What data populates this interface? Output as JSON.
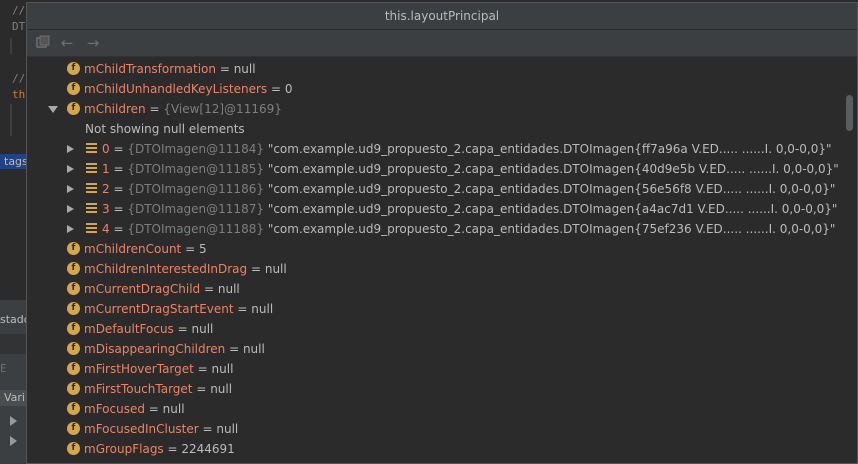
{
  "background": {
    "code_line1": "//",
    "code_line2": "DT",
    "code_line3": "//",
    "code_line4": "th",
    "tag_label": "tags",
    "estado_label": "stado",
    "vari_label": "Vari",
    "e_label": "E"
  },
  "window": {
    "title": "this.layoutPrincipal"
  },
  "toolbar": {
    "icons": [
      "copy-layout-icon",
      "back-arrow-icon",
      "forward-arrow-icon"
    ]
  },
  "tree": {
    "rows": [
      {
        "name": "mChildTransformation",
        "eq": " = ",
        "value": "null"
      },
      {
        "name": "mChildUnhandledKeyListeners",
        "eq": " = ",
        "value": "0"
      },
      {
        "name": "mChildren",
        "eq": " = ",
        "value": "{View[12]@11169}",
        "expanded": true
      },
      {
        "note": "Not showing null elements"
      },
      {
        "index": "0",
        "ref": "{DTOImagen@11184}",
        "value": "\"com.example.ud9_propuesto_2.capa_entidades.DTOImagen{ff7a96a V.ED..... ......I. 0,0-0,0}\""
      },
      {
        "index": "1",
        "ref": "{DTOImagen@11185}",
        "value": "\"com.example.ud9_propuesto_2.capa_entidades.DTOImagen{40d9e5b V.ED..... ......I. 0,0-0,0}\""
      },
      {
        "index": "2",
        "ref": "{DTOImagen@11186}",
        "value": "\"com.example.ud9_propuesto_2.capa_entidades.DTOImagen{56e56f8 V.ED..... ......I. 0,0-0,0}\""
      },
      {
        "index": "3",
        "ref": "{DTOImagen@11187}",
        "value": "\"com.example.ud9_propuesto_2.capa_entidades.DTOImagen{a4ac7d1 V.ED..... ......I. 0,0-0,0}\""
      },
      {
        "index": "4",
        "ref": "{DTOImagen@11188}",
        "value": "\"com.example.ud9_propuesto_2.capa_entidades.DTOImagen{75ef236 V.ED..... ......I. 0,0-0,0}\""
      },
      {
        "name": "mChildrenCount",
        "eq": " = ",
        "value": "5"
      },
      {
        "name": "mChildrenInterestedInDrag",
        "eq": " = ",
        "value": "null"
      },
      {
        "name": "mCurrentDragChild",
        "eq": " = ",
        "value": "null"
      },
      {
        "name": "mCurrentDragStartEvent",
        "eq": " = ",
        "value": "null"
      },
      {
        "name": "mDefaultFocus",
        "eq": " = ",
        "value": "null"
      },
      {
        "name": "mDisappearingChildren",
        "eq": " = ",
        "value": "null"
      },
      {
        "name": "mFirstHoverTarget",
        "eq": " = ",
        "value": "null"
      },
      {
        "name": "mFirstTouchTarget",
        "eq": " = ",
        "value": "null"
      },
      {
        "name": "mFocused",
        "eq": " = ",
        "value": "null"
      },
      {
        "name": "mFocusedInCluster",
        "eq": " = ",
        "value": "null"
      },
      {
        "name": "mGroupFlags",
        "eq": " = ",
        "value": "2244691"
      }
    ]
  },
  "colors": {
    "field_name": "#e8846a",
    "field_icon": "#d4a74c",
    "ref_gray": "#7f7f7f",
    "title_bar": "#3c3f41"
  }
}
